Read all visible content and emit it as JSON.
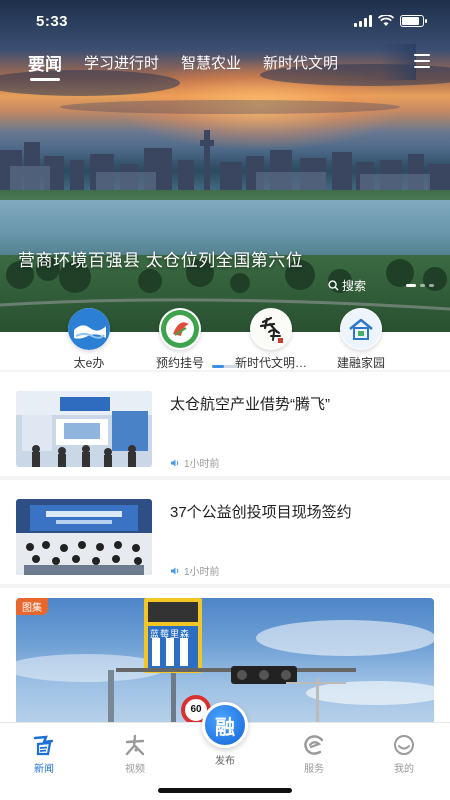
{
  "status_bar": {
    "time": "5:33",
    "battery_level": 0.85
  },
  "tabs": [
    {
      "label": "要闻",
      "active": true
    },
    {
      "label": "学习进行时",
      "active": false
    },
    {
      "label": "智慧农业",
      "active": false
    },
    {
      "label": "新时代文明",
      "active": false
    }
  ],
  "hero": {
    "headline": "营商环境百强县  太仓位列全国第六位",
    "search_label": "搜索"
  },
  "quick_entries": [
    {
      "label": "太e办",
      "icon": "wave-logo-icon"
    },
    {
      "label": "预约挂号",
      "icon": "medical-logo-icon"
    },
    {
      "label": "新时代文明…",
      "icon": "calligraphy-logo-icon"
    },
    {
      "label": "建融家园",
      "icon": "house-logo-icon"
    }
  ],
  "feed": [
    {
      "title": "太仓航空产业借势“腾飞”",
      "time": "1小时前"
    },
    {
      "title": "37个公益创投项目现场签约",
      "time": "1小时前"
    }
  ],
  "gallery": {
    "tag": "图集",
    "sign_text": "蓝莓里森",
    "speed_limit": "60"
  },
  "bottom_nav": [
    {
      "label": "新闻",
      "icon": "news-icon",
      "active": true
    },
    {
      "label": "视频",
      "icon": "video-icon",
      "active": false
    },
    {
      "label": "发布",
      "icon": "publish-icon",
      "active": false,
      "center_glyph": "融"
    },
    {
      "label": "服务",
      "icon": "service-icon",
      "active": false
    },
    {
      "label": "我的",
      "icon": "profile-icon",
      "active": false
    }
  ],
  "colors": {
    "accent": "#1f6fd8",
    "tag": "#e8672e"
  }
}
